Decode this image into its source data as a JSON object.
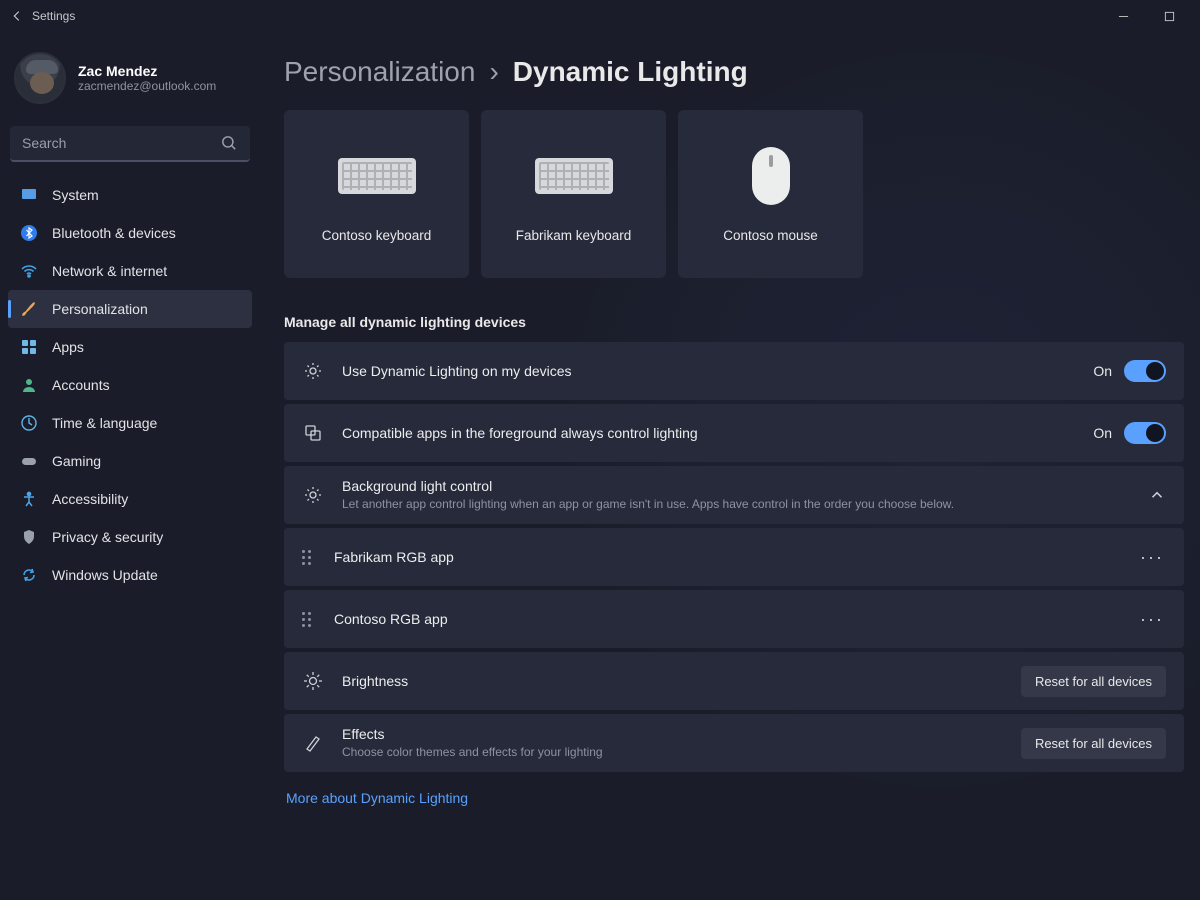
{
  "window": {
    "title": "Settings"
  },
  "user": {
    "name": "Zac Mendez",
    "email": "zacmendez@outlook.com"
  },
  "search": {
    "placeholder": "Search"
  },
  "nav": {
    "items": [
      {
        "label": "System"
      },
      {
        "label": "Bluetooth & devices"
      },
      {
        "label": "Network & internet"
      },
      {
        "label": "Personalization"
      },
      {
        "label": "Apps"
      },
      {
        "label": "Accounts"
      },
      {
        "label": "Time & language"
      },
      {
        "label": "Gaming"
      },
      {
        "label": "Accessibility"
      },
      {
        "label": "Privacy & security"
      },
      {
        "label": "Windows Update"
      }
    ],
    "active_index": 3
  },
  "breadcrumb": {
    "parent": "Personalization",
    "current": "Dynamic Lighting"
  },
  "devices": [
    {
      "label": "Contoso keyboard",
      "kind": "keyboard"
    },
    {
      "label": "Fabrikam keyboard",
      "kind": "keyboard"
    },
    {
      "label": "Contoso mouse",
      "kind": "mouse"
    }
  ],
  "section_title": "Manage all dynamic lighting devices",
  "settings": {
    "use_dynamic": {
      "title": "Use Dynamic Lighting on my devices",
      "state": "On"
    },
    "foreground": {
      "title": "Compatible apps in the foreground always control lighting",
      "state": "On"
    },
    "background": {
      "title": "Background light control",
      "desc": "Let another app control lighting when an app or game isn't in use. Apps have control in the order you choose below."
    },
    "apps": [
      {
        "name": "Fabrikam RGB app"
      },
      {
        "name": "Contoso RGB app"
      }
    ],
    "brightness": {
      "title": "Brightness",
      "button": "Reset for all devices"
    },
    "effects": {
      "title": "Effects",
      "desc": "Choose color themes and effects for your lighting",
      "button": "Reset for all devices"
    }
  },
  "footer_link": "More about Dynamic Lighting"
}
